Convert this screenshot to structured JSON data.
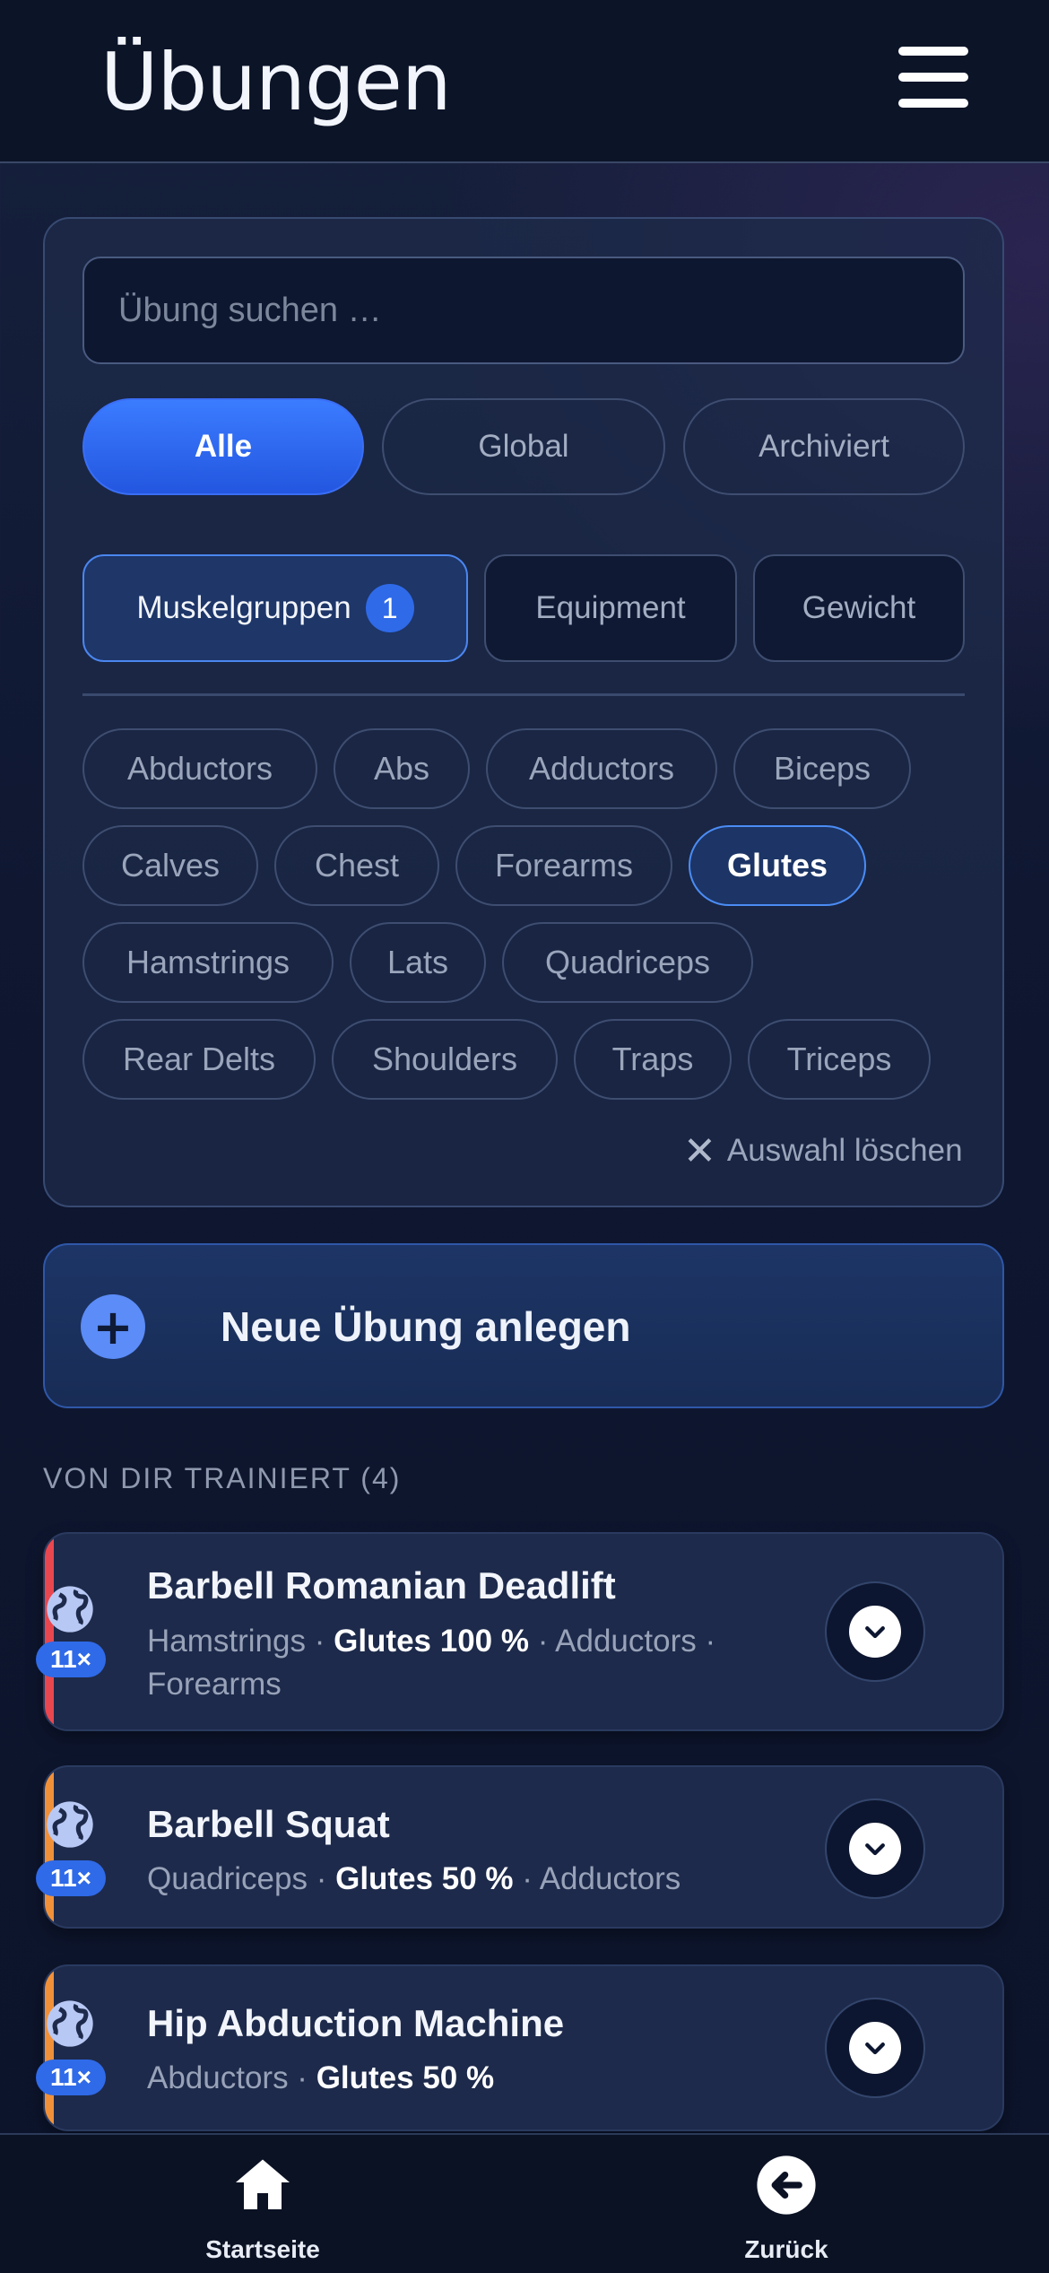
{
  "header": {
    "title": "Übungen",
    "menu_icon": "hamburger-menu-icon"
  },
  "search": {
    "placeholder": "Übung suchen …",
    "value": ""
  },
  "scope_filters": [
    {
      "label": "Alle",
      "active": true
    },
    {
      "label": "Global",
      "active": false
    },
    {
      "label": "Archiviert",
      "active": false
    }
  ],
  "filter_tabs": [
    {
      "label": "Muskelgruppen",
      "badge": "1",
      "active": true
    },
    {
      "label": "Equipment",
      "active": false
    },
    {
      "label": "Gewicht",
      "active": false
    }
  ],
  "muscle_chips": [
    {
      "label": "Abductors",
      "selected": false
    },
    {
      "label": "Abs",
      "selected": false
    },
    {
      "label": "Adductors",
      "selected": false
    },
    {
      "label": "Biceps",
      "selected": false
    },
    {
      "label": "Calves",
      "selected": false
    },
    {
      "label": "Chest",
      "selected": false
    },
    {
      "label": "Forearms",
      "selected": false
    },
    {
      "label": "Glutes",
      "selected": true
    },
    {
      "label": "Hamstrings",
      "selected": false
    },
    {
      "label": "Lats",
      "selected": false
    },
    {
      "label": "Quadriceps",
      "selected": false
    },
    {
      "label": "Rear Delts",
      "selected": false
    },
    {
      "label": "Shoulders",
      "selected": false
    },
    {
      "label": "Traps",
      "selected": false
    },
    {
      "label": "Triceps",
      "selected": false
    }
  ],
  "clear_selection": {
    "label": "Auswahl löschen",
    "icon": "close-icon"
  },
  "new_exercise": {
    "label": "Neue Übung anlegen",
    "icon": "plus-icon"
  },
  "section": {
    "title": "VON DIR TRAINIERT",
    "count": "(4)"
  },
  "exercises": [
    {
      "name": "Barbell Romanian Deadlift",
      "count": "11×",
      "accent": "#e8474f",
      "muscles_before": "Hamstrings · ",
      "muscles_highlight": "Glutes 100 %",
      "muscles_after": " · Adductors · Forearms"
    },
    {
      "name": "Barbell Squat",
      "count": "11×",
      "accent": "#f0913a",
      "muscles_before": "Quadriceps · ",
      "muscles_highlight": "Glutes 50 %",
      "muscles_after": " · Adductors"
    },
    {
      "name": "Hip Abduction Machine",
      "count": "11×",
      "accent": "#f0913a",
      "muscles_before": "Abductors · ",
      "muscles_highlight": "Glutes 50 %",
      "muscles_after": ""
    }
  ],
  "bottom_nav": [
    {
      "label": "Startseite",
      "icon": "home-icon"
    },
    {
      "label": "Zurück",
      "icon": "back-arrow-icon"
    }
  ],
  "colors": {
    "accent_blue": "#2f6ae8",
    "background": "#0f1731"
  }
}
